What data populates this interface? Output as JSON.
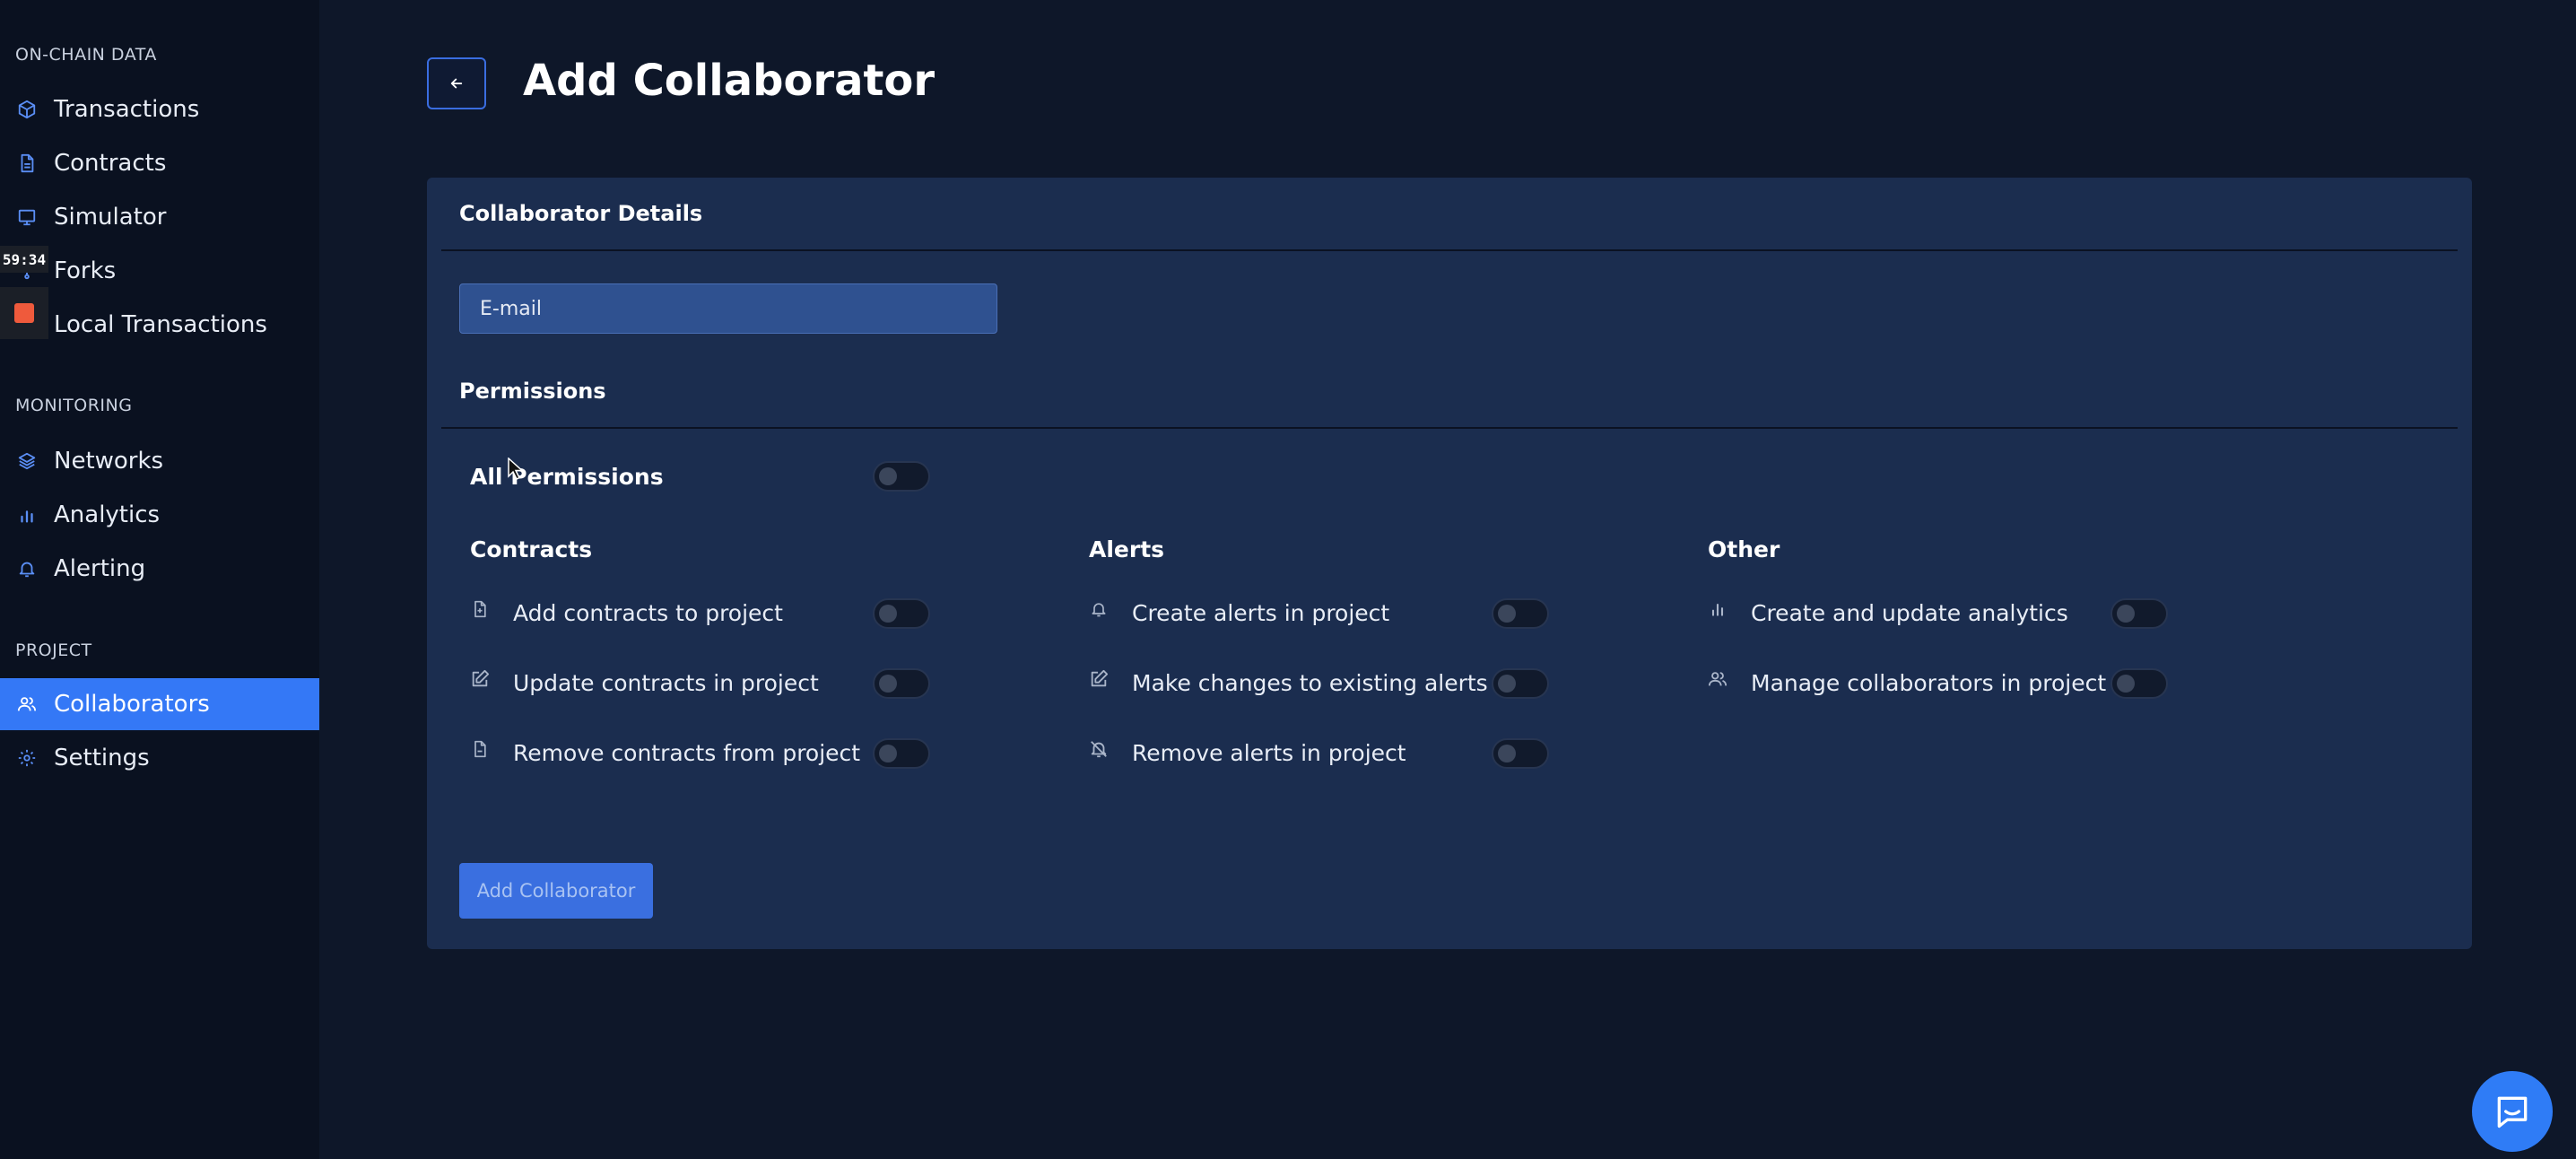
{
  "sidebar": {
    "sections": {
      "onchain": "ON-CHAIN DATA",
      "monitoring": "MONITORING",
      "project": "PROJECT"
    },
    "items": [
      {
        "label": "Transactions",
        "icon": "cube-icon"
      },
      {
        "label": "Contracts",
        "icon": "document-icon"
      },
      {
        "label": "Simulator",
        "icon": "monitor-icon"
      },
      {
        "label": "Forks",
        "icon": "fork-icon"
      },
      {
        "label": "Local Transactions",
        "icon": "terminal-icon"
      },
      {
        "label": "Networks",
        "icon": "layers-icon"
      },
      {
        "label": "Analytics",
        "icon": "bar-chart-icon"
      },
      {
        "label": "Alerting",
        "icon": "bell-icon"
      },
      {
        "label": "Collaborators",
        "icon": "users-icon",
        "active": true
      },
      {
        "label": "Settings",
        "icon": "gear-icon"
      }
    ]
  },
  "recorder": {
    "timer": "59:34"
  },
  "header": {
    "title": "Add Collaborator"
  },
  "form": {
    "details_heading": "Collaborator Details",
    "email_placeholder": "E-mail",
    "email_value": "",
    "permissions_heading": "Permissions",
    "all_permissions_label": "All Permissions",
    "all_permissions_on": false,
    "columns": [
      {
        "title": "Contracts",
        "items": [
          {
            "label": "Add contracts to project",
            "icon": "file-plus-icon",
            "on": false
          },
          {
            "label": "Update contracts in project",
            "icon": "edit-icon",
            "on": false
          },
          {
            "label": "Remove contracts from project",
            "icon": "file-icon",
            "on": false
          }
        ]
      },
      {
        "title": "Alerts",
        "items": [
          {
            "label": "Create alerts in project",
            "icon": "bell-icon",
            "on": false
          },
          {
            "label": "Make changes to existing alerts",
            "icon": "edit-icon",
            "on": false
          },
          {
            "label": "Remove alerts in project",
            "icon": "bell-off-icon",
            "on": false
          }
        ]
      },
      {
        "title": "Other",
        "items": [
          {
            "label": "Create and update analytics",
            "icon": "bar-chart-icon",
            "on": false
          },
          {
            "label": "Manage collaborators in project",
            "icon": "users-icon",
            "on": false
          }
        ]
      }
    ],
    "submit_label": "Add Collaborator"
  },
  "colors": {
    "background": "#0e1729",
    "sidebar": "#0a1120",
    "card": "#1b2d4f",
    "accent": "#3478f6",
    "recorder_stop": "#ef5a3c"
  }
}
